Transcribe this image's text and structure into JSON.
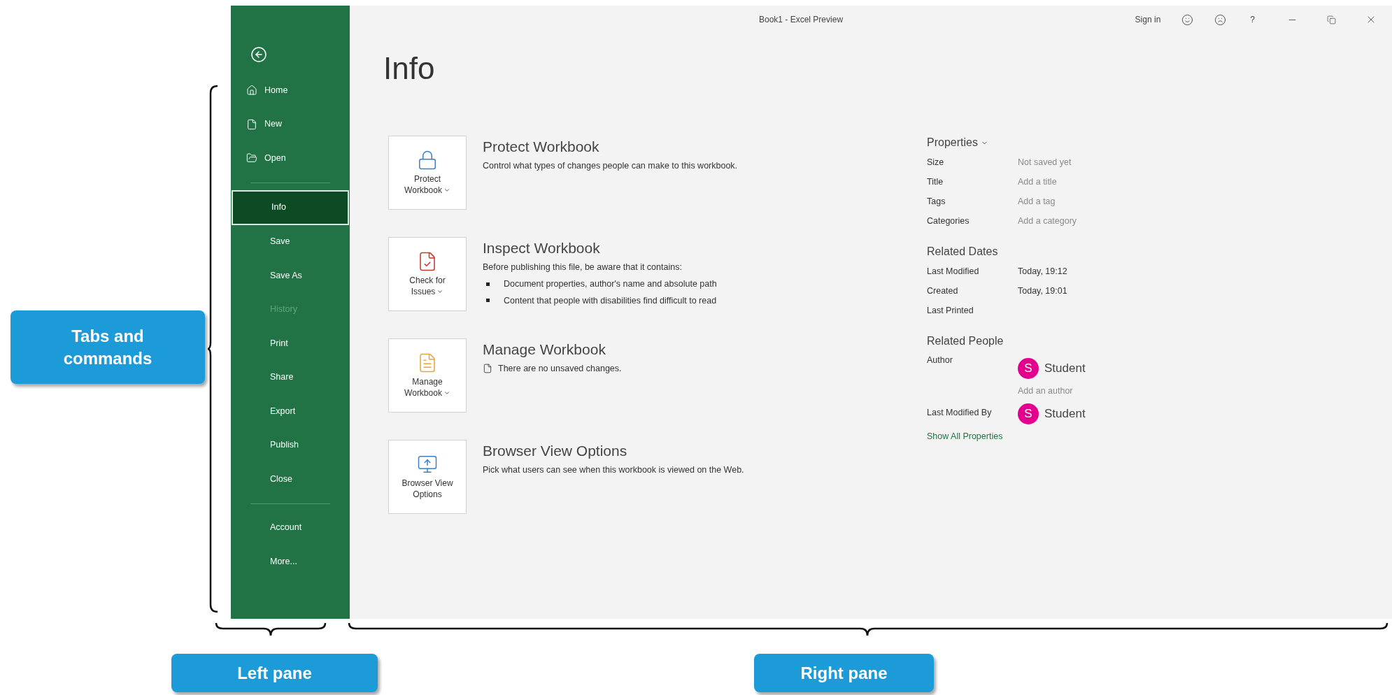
{
  "title_bar": {
    "title": "Book1  -  Excel Preview",
    "sign_in": "Sign in",
    "help": "?"
  },
  "nav": {
    "groups": [
      [
        {
          "label": "Home",
          "selected": false,
          "disabled": false
        },
        {
          "label": "New",
          "selected": false,
          "disabled": false
        },
        {
          "label": "Open",
          "selected": false,
          "disabled": false
        }
      ],
      [
        {
          "label": "Info",
          "selected": true,
          "disabled": false
        },
        {
          "label": "Save",
          "selected": false,
          "disabled": false
        },
        {
          "label": "Save As",
          "selected": false,
          "disabled": false
        },
        {
          "label": "History",
          "selected": false,
          "disabled": true
        },
        {
          "label": "Print",
          "selected": false,
          "disabled": false
        },
        {
          "label": "Share",
          "selected": false,
          "disabled": false
        },
        {
          "label": "Export",
          "selected": false,
          "disabled": false
        },
        {
          "label": "Publish",
          "selected": false,
          "disabled": false
        },
        {
          "label": "Close",
          "selected": false,
          "disabled": false
        }
      ],
      [
        {
          "label": "Account",
          "selected": false,
          "disabled": false
        },
        {
          "label": "More...",
          "selected": false,
          "disabled": false
        }
      ]
    ]
  },
  "page_title": "Info",
  "sections": [
    {
      "title": "Protect Workbook",
      "button_lines": [
        "Protect",
        "Workbook"
      ],
      "has_menu": true,
      "kind": "text",
      "description": "Control what types of changes people can make to this workbook."
    },
    {
      "title": "Inspect Workbook",
      "button_lines": [
        "Check for",
        "Issues"
      ],
      "has_menu": true,
      "kind": "bullets",
      "description": "Before publishing this file, be aware that it contains:",
      "bullets": [
        "Document properties, author's name and absolute path",
        "Content that people with disabilities find difficult to read"
      ]
    },
    {
      "title": "Manage Workbook",
      "button_lines": [
        "Manage",
        "Workbook"
      ],
      "has_menu": true,
      "kind": "status",
      "description": "There are no unsaved changes."
    },
    {
      "title": "Browser View Options",
      "button_lines": [
        "Browser View",
        "Options"
      ],
      "has_menu": false,
      "kind": "text",
      "description": "Pick what users can see when this workbook is viewed on the Web."
    }
  ],
  "properties": {
    "heading": "Properties",
    "rows": [
      {
        "label": "Size",
        "value": "Not saved yet",
        "muted": true
      },
      {
        "label": "Title",
        "value": "Add a title",
        "muted": true
      },
      {
        "label": "Tags",
        "value": "Add a tag",
        "muted": true
      },
      {
        "label": "Categories",
        "value": "Add a category",
        "muted": true
      }
    ]
  },
  "related_dates": {
    "heading": "Related Dates",
    "rows": [
      {
        "label": "Last Modified",
        "value": "Today, 19:12",
        "muted": false
      },
      {
        "label": "Created",
        "value": "Today, 19:01",
        "muted": false
      },
      {
        "label": "Last Printed"
      }
    ]
  },
  "related_people": {
    "heading": "Related People",
    "rows": [
      {
        "label": "Author",
        "initial": "S",
        "name": "Student",
        "add_link": "Add an author"
      },
      {
        "label": "Last Modified By",
        "initial": "S",
        "name": "Student"
      }
    ]
  },
  "show_all": "Show All Properties",
  "annotations": {
    "side": "Tabs and commands",
    "bottom": [
      "Left pane",
      "Right pane"
    ]
  }
}
